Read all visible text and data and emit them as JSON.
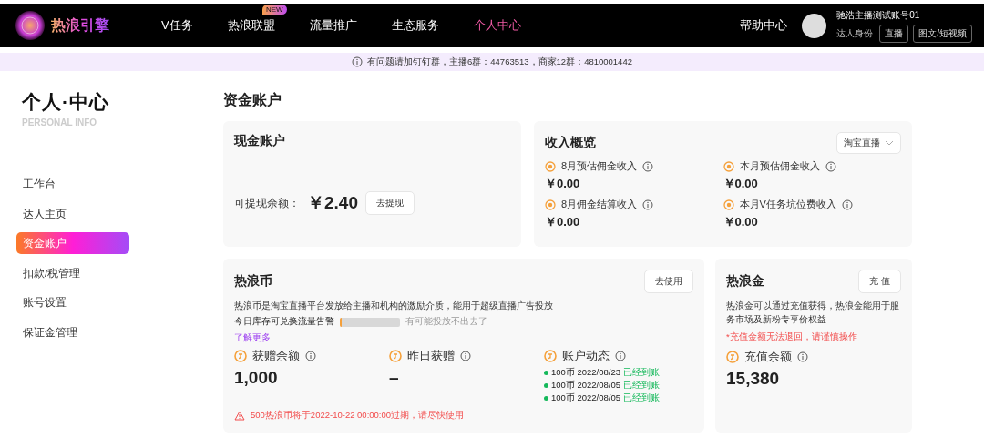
{
  "header": {
    "logo_text": "热浪引擎",
    "nav": [
      {
        "label": "V任务",
        "selected": false
      },
      {
        "label": "热浪联盟",
        "selected": false,
        "badge": "NEW"
      },
      {
        "label": "流量推广",
        "selected": false
      },
      {
        "label": "生态服务",
        "selected": false
      },
      {
        "label": "个人中心",
        "selected": true
      }
    ],
    "help": "帮助中心",
    "user": {
      "name": "驰浩主播测试账号01",
      "role": "达人身份",
      "tags": [
        "直播",
        "图文/短视频"
      ]
    }
  },
  "notice": "有问题请加钉钉群，主播6群：44763513，商家12群：4810001442",
  "sidebar": {
    "title": "个人·中心",
    "subtitle": "PERSONAL INFO",
    "items": [
      {
        "label": "工作台",
        "selected": false
      },
      {
        "label": "达人主页",
        "selected": false
      },
      {
        "label": "资金账户",
        "selected": true
      },
      {
        "label": "扣款/税管理",
        "selected": false
      },
      {
        "label": "账号设置",
        "selected": false
      },
      {
        "label": "保证金管理",
        "selected": false
      }
    ]
  },
  "page_title": "资金账户",
  "cash_account": {
    "title": "现金账户",
    "label": "可提现余额：",
    "amount": "￥2.40",
    "button": "去提现"
  },
  "income": {
    "title": "收入概览",
    "dropdown": "淘宝直播",
    "stats": [
      {
        "label": "8月预估佣金收入",
        "value": "￥0.00"
      },
      {
        "label": "本月预估佣金收入",
        "value": "￥0.00"
      },
      {
        "label": "8月佣金结算收入",
        "value": "￥0.00"
      },
      {
        "label": "本月V任务坑位费收入",
        "value": "￥0.00"
      }
    ]
  },
  "coins": {
    "title": "热浪币",
    "button": "去使用",
    "description": "热浪币是淘宝直播平台发放给主播和机构的激励介质，能用于超级直播广告投放",
    "stock": {
      "label": "今日库存可兑换流量告警",
      "level": 0.03,
      "hint": "有可能投放不出去了"
    },
    "link": "了解更多",
    "stats": [
      {
        "label": "获赠余额",
        "value": "1,000"
      },
      {
        "label": "昨日获赠",
        "value": "–"
      }
    ],
    "activity": {
      "label": "账户动态",
      "entries": [
        {
          "text": "100币 2022/08/23",
          "status": "已经到账"
        },
        {
          "text": "100币 2022/08/05",
          "status": "已经到账"
        },
        {
          "text": "100币 2022/08/05",
          "status": "已经到账"
        }
      ]
    },
    "warning": "500热浪币将于2022-10-22 00:00:00过期，请尽快使用"
  },
  "gold": {
    "title": "热浪金",
    "button": "充 值",
    "description": "热浪金可以通过充值获得，热浪金能用于服务市场及新粉专享价权益",
    "note": "*充值金额无法退回，请谨慎操作",
    "stat": {
      "label": "充值余额",
      "value": "15,380"
    }
  }
}
